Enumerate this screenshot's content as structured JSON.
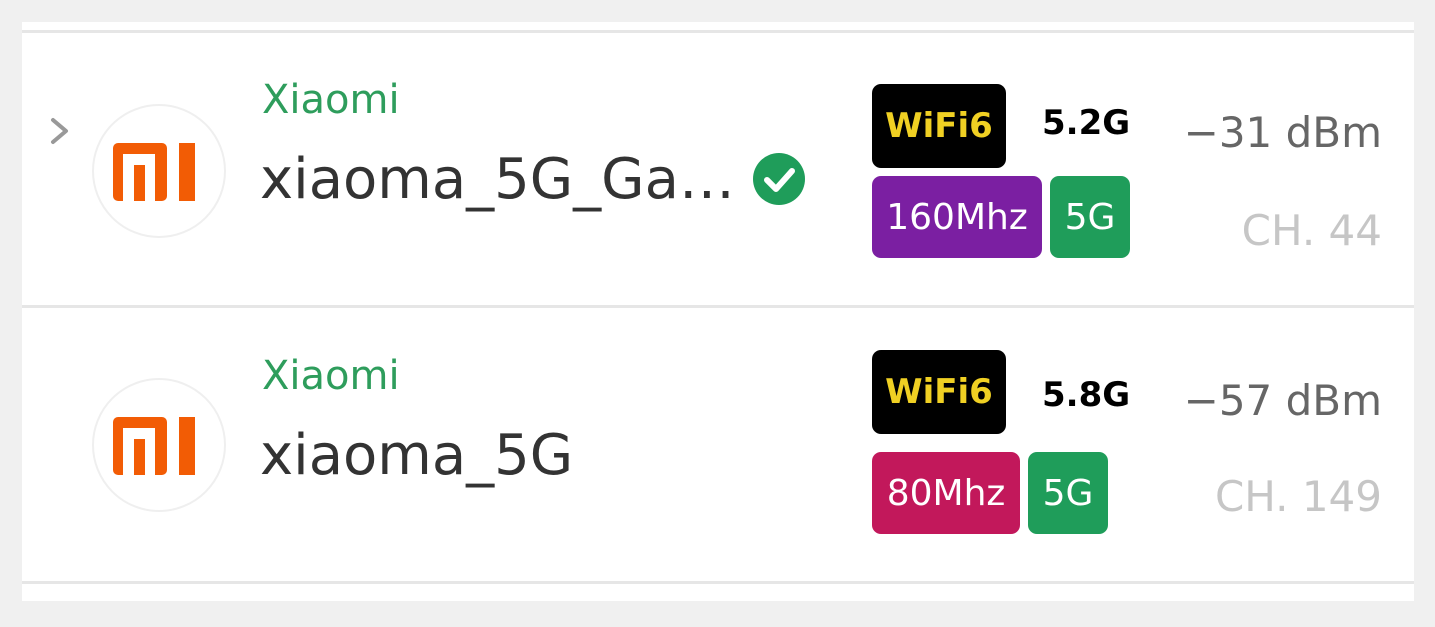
{
  "networks": [
    {
      "vendor": "Xiaomi",
      "ssid": "xiaoma_5G_Ga…",
      "connected": true,
      "standard": "WiFi6",
      "frequency": "5.2G",
      "bandwidth": "160Mhz",
      "bandwidth_color": "#7b1fa2",
      "band": "5G",
      "signal": "−31 dBm",
      "channel": "CH. 44"
    },
    {
      "vendor": "Xiaomi",
      "ssid": "xiaoma_5G",
      "connected": false,
      "standard": "WiFi6",
      "frequency": "5.8G",
      "bandwidth": "80Mhz",
      "bandwidth_color": "#c2185b",
      "band": "5G",
      "signal": "−57 dBm",
      "channel": "CH. 149"
    }
  ],
  "colors": {
    "vendor_green": "#2e9d5c",
    "band_green": "#1f9d5a",
    "wifi_badge_text": "#f0d023",
    "logo_orange": "#f25c05"
  }
}
